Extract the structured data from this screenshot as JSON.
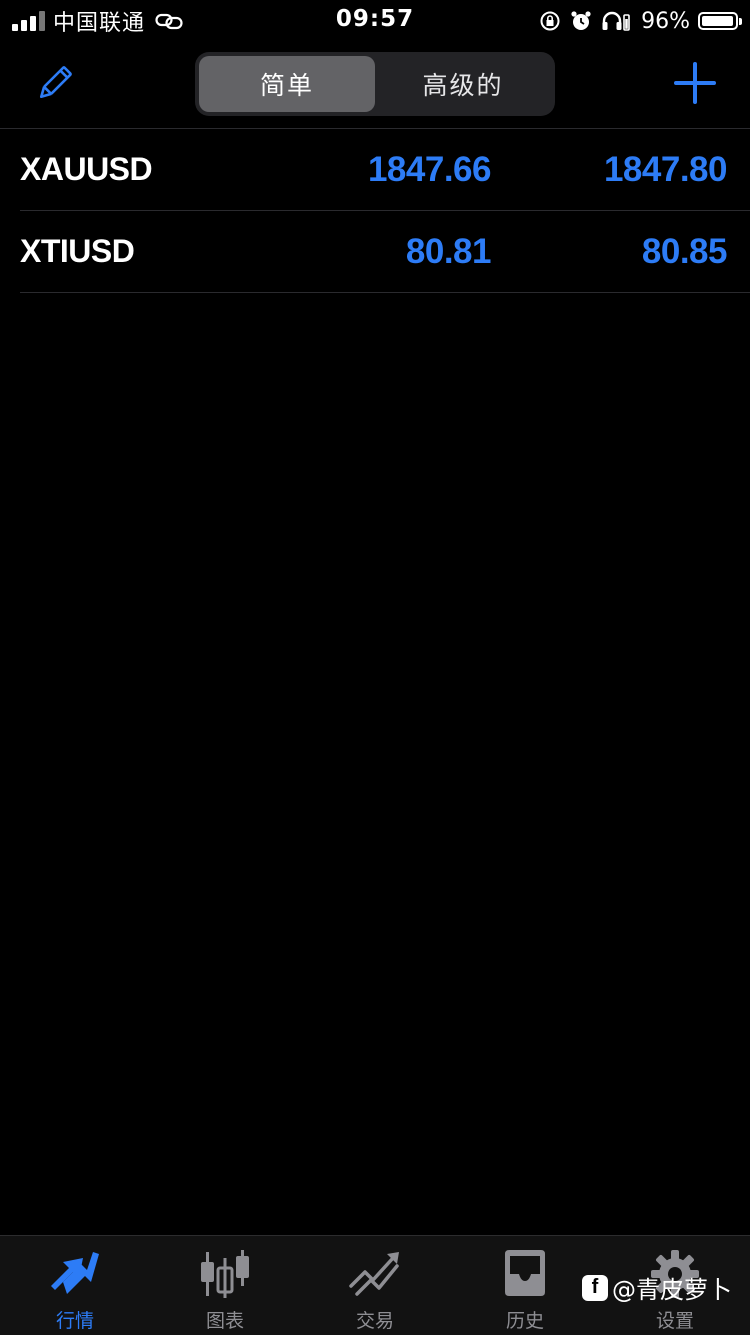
{
  "status_bar": {
    "carrier": "中国联通",
    "time": "09:57",
    "battery_percent": "96%",
    "battery_level": 0.96
  },
  "nav": {
    "segments": [
      {
        "label": "简单",
        "selected": true
      },
      {
        "label": "高级的",
        "selected": false
      }
    ],
    "edit_icon": "pencil-icon",
    "add_icon": "plus-icon",
    "accent_color": "#2d7cf6"
  },
  "quotes": [
    {
      "symbol": "XAUUSD",
      "bid": "1847.66",
      "ask": "1847.80"
    },
    {
      "symbol": "XTIUSD",
      "bid": "80.81",
      "ask": "80.85"
    }
  ],
  "tabs": [
    {
      "label": "行情",
      "icon": "quotes-arrows-icon",
      "active": true
    },
    {
      "label": "图表",
      "icon": "candlestick-chart-icon",
      "active": false
    },
    {
      "label": "交易",
      "icon": "trade-trend-icon",
      "active": false
    },
    {
      "label": "历史",
      "icon": "history-tray-icon",
      "active": false
    },
    {
      "label": "设置",
      "icon": "settings-gear-icon",
      "active": false
    }
  ],
  "watermark": {
    "text": "@青皮萝卜"
  }
}
